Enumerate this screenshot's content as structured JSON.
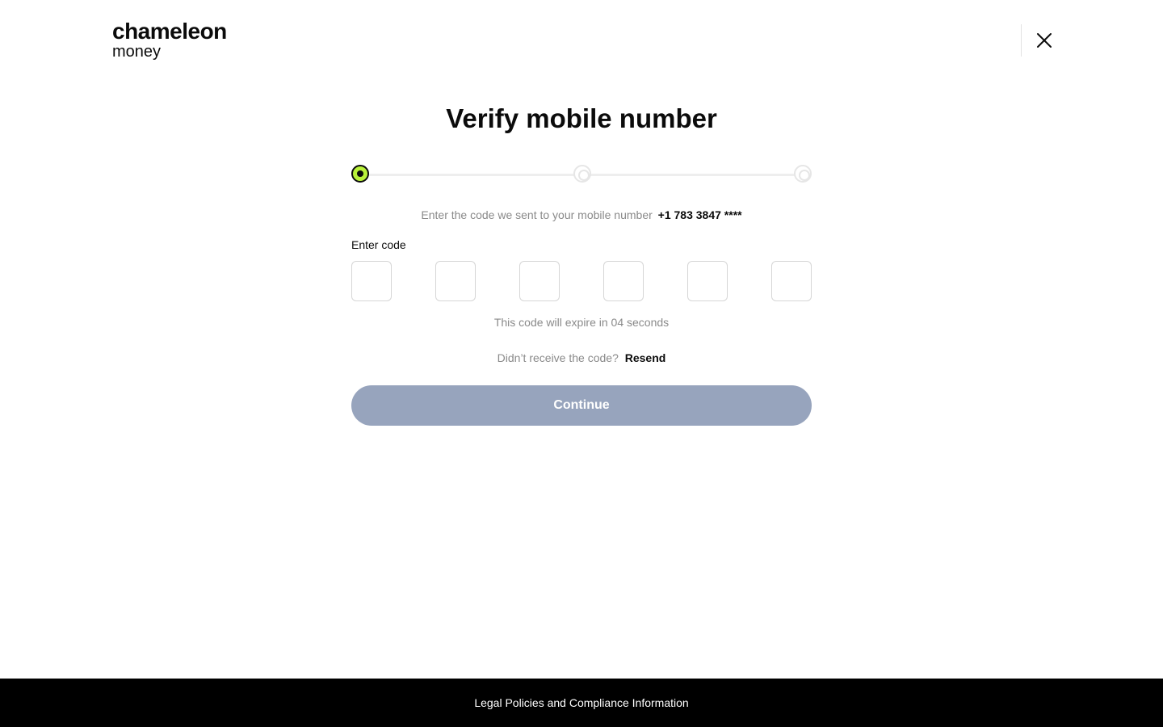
{
  "header": {
    "logo_line1": "chameleon",
    "logo_line2": "money",
    "close_icon": "close-icon"
  },
  "main": {
    "title": "Verify mobile number",
    "stepper": {
      "total_steps": 3,
      "current_step": 1
    },
    "instruction_text": "Enter the code we sent to your mobile number",
    "phone_number": "+1 783 3847 ****",
    "code_label": "Enter code",
    "code_digits": [
      "",
      "",
      "",
      "",
      "",
      ""
    ],
    "expire_text": "This code will expire in 04 seconds",
    "resend_prompt": "Didn’t receive the code?",
    "resend_label": "Resend",
    "continue_label": "Continue"
  },
  "footer": {
    "link_label": "Legal Policies and Compliance Information"
  },
  "colors": {
    "accent": "#b9f23a",
    "button_disabled": "#97a4bd",
    "footer_bg": "#000000",
    "muted_text": "#8a8a8a"
  }
}
